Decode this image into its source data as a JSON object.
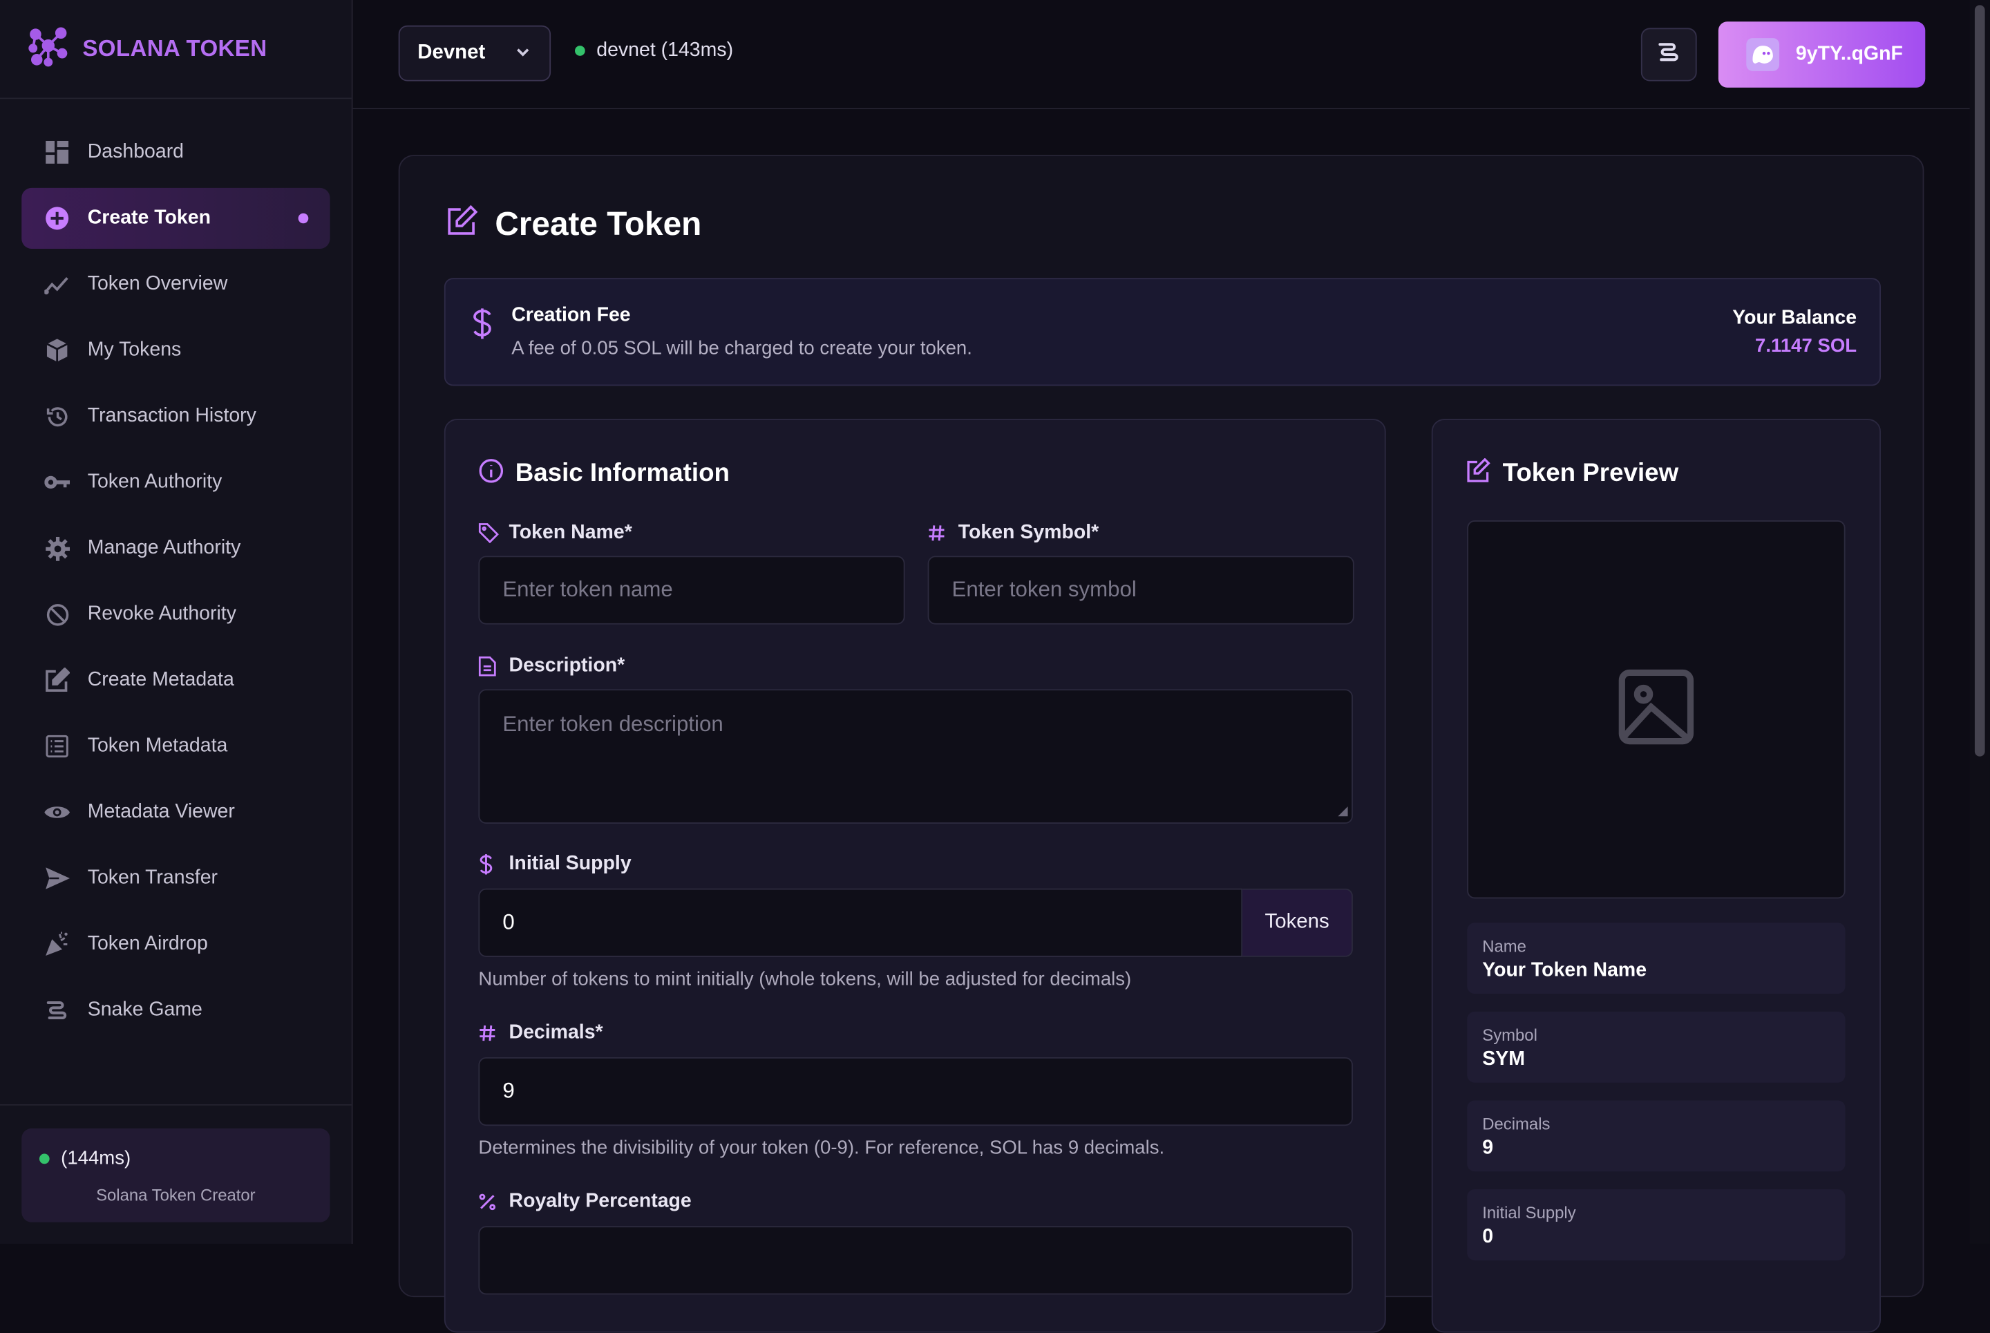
{
  "brand": {
    "name": "SOLANA TOKEN"
  },
  "sidebar": {
    "items": [
      {
        "label": "Dashboard",
        "icon": "dashboard-icon"
      },
      {
        "label": "Create Token",
        "icon": "plus-circle-icon",
        "active": true
      },
      {
        "label": "Token Overview",
        "icon": "chart-line-icon"
      },
      {
        "label": "My Tokens",
        "icon": "cube-icon"
      },
      {
        "label": "Transaction History",
        "icon": "history-icon"
      },
      {
        "label": "Token Authority",
        "icon": "key-icon"
      },
      {
        "label": "Manage Authority",
        "icon": "gear-icon"
      },
      {
        "label": "Revoke Authority",
        "icon": "ban-icon"
      },
      {
        "label": "Create Metadata",
        "icon": "edit-icon"
      },
      {
        "label": "Token Metadata",
        "icon": "list-icon"
      },
      {
        "label": "Metadata Viewer",
        "icon": "eye-icon"
      },
      {
        "label": "Token Transfer",
        "icon": "send-icon"
      },
      {
        "label": "Token Airdrop",
        "icon": "party-icon"
      },
      {
        "label": "Snake Game",
        "icon": "snake-icon"
      }
    ],
    "footer": {
      "latency": "(144ms)",
      "app_name": "Solana Token Creator"
    }
  },
  "header": {
    "network": "Devnet",
    "network_status": "devnet (143ms)",
    "wallet": "9yTY..qGnF"
  },
  "page": {
    "title": "Create Token",
    "fee": {
      "title": "Creation Fee",
      "description": "A fee of 0.05 SOL will be charged to create your token.",
      "balance_label": "Your Balance",
      "balance_value": "7.1147 SOL"
    },
    "basic": {
      "title": "Basic Information",
      "token_name_label": "Token Name*",
      "token_name_placeholder": "Enter token name",
      "token_symbol_label": "Token Symbol*",
      "token_symbol_placeholder": "Enter token symbol",
      "description_label": "Description*",
      "description_placeholder": "Enter token description",
      "initial_supply_label": "Initial Supply",
      "initial_supply_value": "0",
      "initial_supply_unit": "Tokens",
      "initial_supply_hint": "Number of tokens to mint initially (whole tokens, will be adjusted for decimals)",
      "decimals_label": "Decimals*",
      "decimals_value": "9",
      "decimals_hint": "Determines the divisibility of your token (0-9). For reference, SOL has 9 decimals.",
      "royalty_label": "Royalty Percentage"
    },
    "preview": {
      "title": "Token Preview",
      "fields": [
        {
          "label": "Name",
          "value": "Your Token Name"
        },
        {
          "label": "Symbol",
          "value": "SYM"
        },
        {
          "label": "Decimals",
          "value": "9"
        },
        {
          "label": "Initial Supply",
          "value": "0"
        }
      ]
    }
  },
  "colors": {
    "accent": "#c77dff",
    "brand": "#b56ef2",
    "status_ok": "#34c26b",
    "background": "#0d0c15"
  }
}
